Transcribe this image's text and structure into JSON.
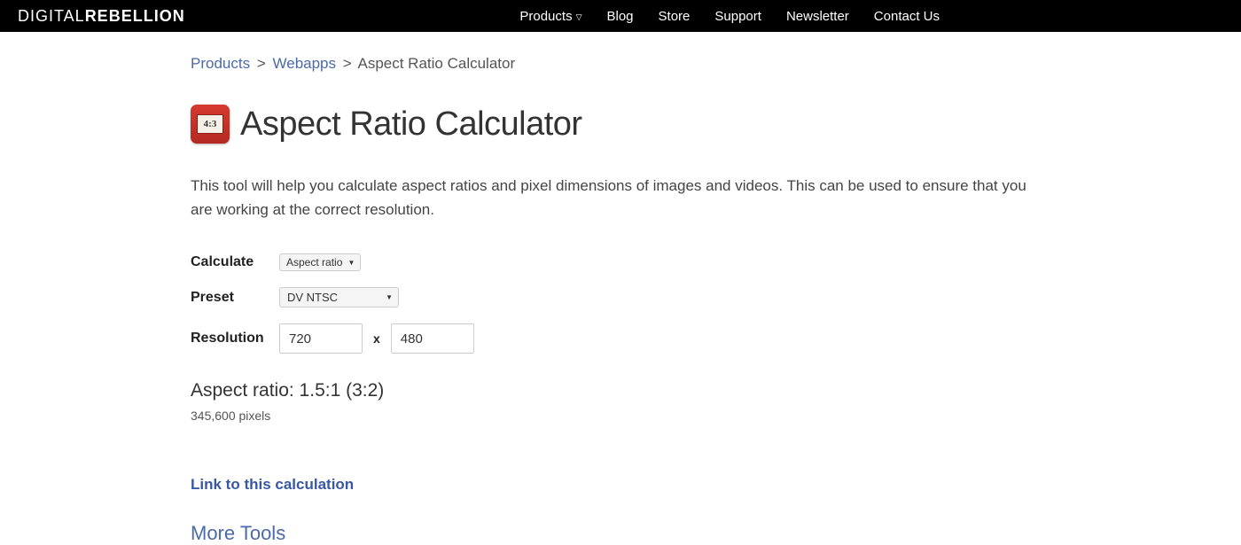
{
  "logo": {
    "part1": "DIGITAL",
    "part2": "REBELLION"
  },
  "nav": {
    "products": "Products",
    "blog": "Blog",
    "store": "Store",
    "support": "Support",
    "newsletter": "Newsletter",
    "contact": "Contact Us"
  },
  "breadcrumb": {
    "products": "Products",
    "webapps": "Webapps",
    "current": "Aspect Ratio Calculator"
  },
  "page": {
    "icon_text": "4:3",
    "title": "Aspect Ratio Calculator",
    "description": "This tool will help you calculate aspect ratios and pixel dimensions of images and videos. This can be used to ensure that you are working at the correct resolution."
  },
  "form": {
    "calculate_label": "Calculate",
    "calculate_value": "Aspect ratio",
    "preset_label": "Preset",
    "preset_value": "DV NTSC",
    "resolution_label": "Resolution",
    "resolution_width": "720",
    "resolution_x": "x",
    "resolution_height": "480"
  },
  "result": {
    "ratio": "Aspect ratio: 1.5:1 (3:2)",
    "pixels": "345,600 pixels"
  },
  "links": {
    "link_calc": "Link to this calculation",
    "more_tools": "More Tools"
  }
}
